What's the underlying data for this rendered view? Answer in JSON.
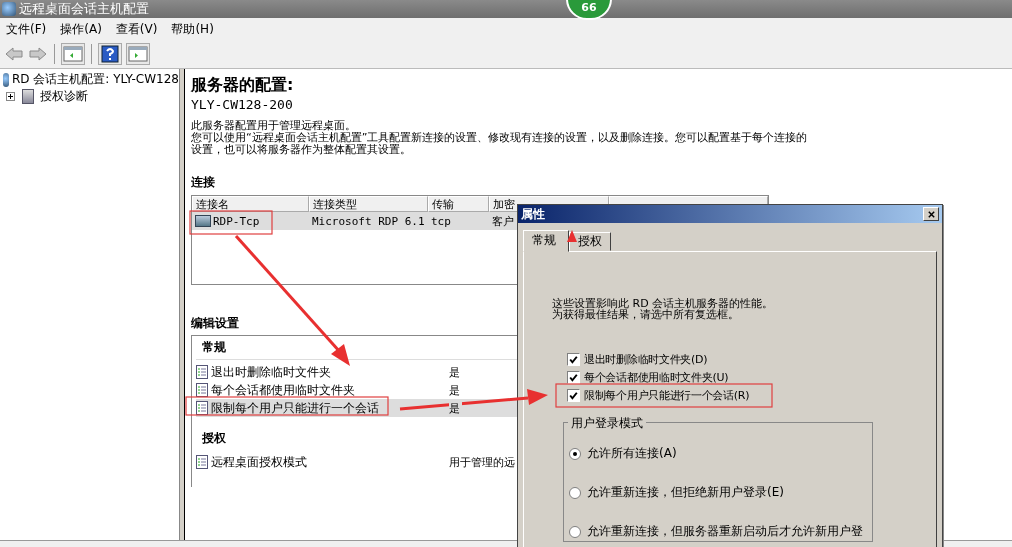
{
  "window": {
    "title": "远程桌面会话主机配置",
    "badge": "66"
  },
  "menu": [
    "文件(F)",
    "操作(A)",
    "查看(V)",
    "帮助(H)"
  ],
  "tree": [
    {
      "label": "RD 会话主机配置: YLY-CW128"
    },
    {
      "label": "授权诊断",
      "expanded": false
    }
  ],
  "content": {
    "heading": "服务器的配置:",
    "server": "YLY-CW128-200",
    "description": [
      "此服务器配置用于管理远程桌面。",
      "您可以使用“远程桌面会话主机配置”工具配置新连接的设置、修改现有连接的设置，以及删除连接。您可以配置基于每个连接的设置，也可以将服务器作为整体配置其设置。"
    ],
    "connections": {
      "title": "连接",
      "columns": [
        "连接名",
        "连接类型",
        "传输",
        "加密"
      ],
      "rows": [
        {
          "cells": [
            "RDP-Tcp",
            "Microsoft RDP 6.1",
            "tcp",
            "客户"
          ],
          "selected": true
        }
      ]
    },
    "settings": {
      "title": "编辑设置",
      "groups": [
        {
          "title": "常规",
          "items": [
            {
              "label": "退出时删除临时文件夹",
              "value": "是",
              "selected": false
            },
            {
              "label": "每个会话都使用临时文件夹",
              "value": "是",
              "selected": false
            },
            {
              "label": "限制每个用户只能进行一个会话",
              "value": "是",
              "selected": true
            }
          ]
        },
        {
          "title": "授权",
          "items": [
            {
              "label": "远程桌面授权模式",
              "value": "用于管理的远",
              "selected": false
            }
          ]
        }
      ]
    }
  },
  "dialog": {
    "title": "属性",
    "tabs": [
      {
        "label": "常规",
        "selected": true
      },
      {
        "label": "授权",
        "selected": false
      }
    ],
    "intro": [
      "这些设置影响此 RD 会话主机服务器的性能。",
      "为获得最佳结果，请选中所有复选框。"
    ],
    "checkboxes": [
      {
        "label": "退出时删除临时文件夹(D)",
        "checked": true
      },
      {
        "label": "每个会话都使用临时文件夹(U)",
        "checked": true
      },
      {
        "label": "限制每个用户只能进行一个会话(R)",
        "checked": true
      }
    ],
    "group": {
      "title": "用户登录模式",
      "radios": [
        {
          "label": "允许所有连接(A)",
          "selected": true
        },
        {
          "label": "允许重新连接，但拒绝新用户登录(E)",
          "selected": false
        },
        {
          "label": "允许重新连接，但服务器重新启动后才允许新用户登",
          "selected": false
        }
      ]
    }
  }
}
